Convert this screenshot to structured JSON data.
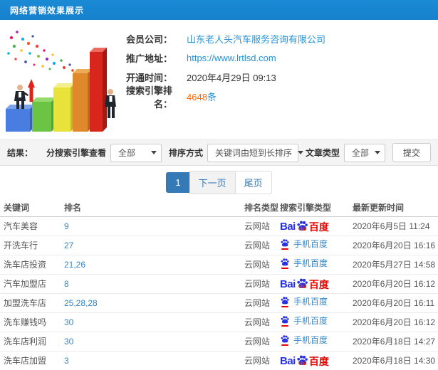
{
  "header": {
    "title": "网络营销效果展示"
  },
  "info": {
    "fields": [
      {
        "label": "会员公司：",
        "value": "山东老人头汽车服务咨询有限公司"
      },
      {
        "label": "推广地址：",
        "value": "https://www.lrtlsd.com"
      },
      {
        "label": "开通时间：",
        "value": "2020年4月29日 09:13"
      },
      {
        "label": "搜索引擎排名：",
        "value": "4648",
        "suffix": "条"
      }
    ]
  },
  "clipart": {
    "name": "3d-bar-chart-growth-illustration",
    "bar_colors": [
      "#4a7de0",
      "#6cc444",
      "#e8e23a",
      "#e0892c",
      "#d9261c"
    ],
    "confetti_colors": [
      "#e91e63",
      "#9c27b0",
      "#3f51b5",
      "#03a9f4",
      "#4caf50",
      "#ffc107",
      "#ff5722",
      "#f44336",
      "#00bcd4",
      "#8bc34a"
    ]
  },
  "filters": {
    "section_label": "结果：",
    "engine_label": "分搜索引擎查看",
    "engine_value": "全部",
    "sort_label": "排序方式",
    "sort_value": "关键词由短到长排序",
    "type_label": "文章类型",
    "type_value": "全部",
    "submit_label": "提交"
  },
  "pagination": {
    "current": "1",
    "next": "下一页",
    "last": "尾页"
  },
  "logos": {
    "bai": "Bai",
    "du": "du",
    "cn": "百度",
    "mobile_label": "手机百度",
    "baidu_blue": "#2932e1",
    "baidu_red": "#e10602"
  },
  "table": {
    "columns": [
      "关键词",
      "排名",
      "排名类型",
      "搜索引擎类型",
      "最新更新时间"
    ],
    "rows": [
      {
        "keyword": "汽车美容",
        "rank": "9",
        "rank_type": "云网站",
        "engine": "baidu",
        "time": "2020年6月5日 11:24"
      },
      {
        "keyword": "开洗车行",
        "rank": "27",
        "rank_type": "云网站",
        "engine": "mobile",
        "time": "2020年6月20日 16:16"
      },
      {
        "keyword": "洗车店投资",
        "rank": "21,26",
        "rank_type": "云网站",
        "engine": "mobile",
        "time": "2020年5月27日 14:58"
      },
      {
        "keyword": "汽车加盟店",
        "rank": "8",
        "rank_type": "云网站",
        "engine": "baidu",
        "time": "2020年6月20日 16:12"
      },
      {
        "keyword": "加盟洗车店",
        "rank": "25,28,28",
        "rank_type": "云网站",
        "engine": "mobile",
        "time": "2020年6月20日 16:11"
      },
      {
        "keyword": "洗车赚钱吗",
        "rank": "30",
        "rank_type": "云网站",
        "engine": "mobile",
        "time": "2020年6月20日 16:12"
      },
      {
        "keyword": "洗车店利润",
        "rank": "30",
        "rank_type": "云网站",
        "engine": "mobile",
        "time": "2020年6月18日 14:27"
      },
      {
        "keyword": "洗车店加盟",
        "rank": "3",
        "rank_type": "云网站",
        "engine": "baidu",
        "time": "2020年6月18日 14:30"
      }
    ]
  }
}
